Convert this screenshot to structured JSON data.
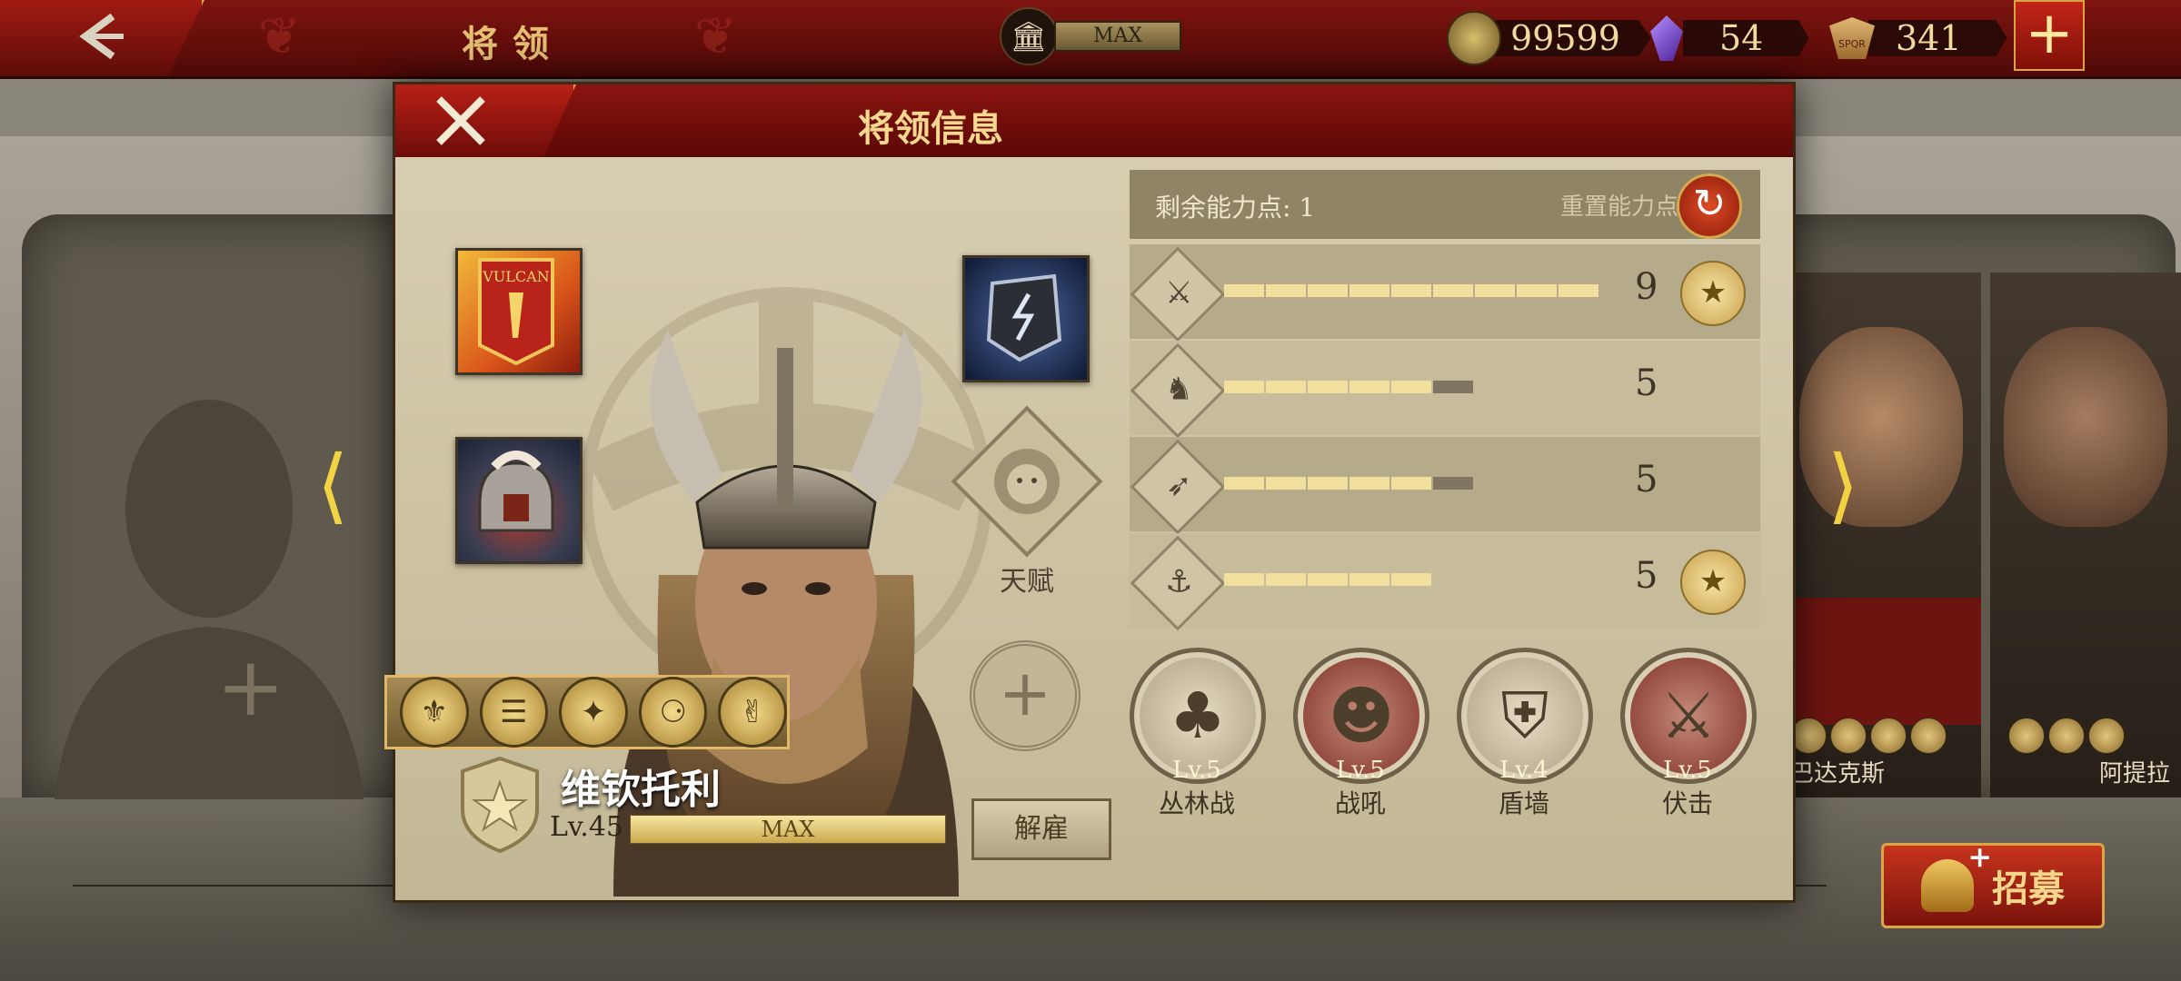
{
  "topbar": {
    "title": "将领",
    "building_max": "MAX",
    "gold": "99599",
    "gems": "54",
    "spqr": "341"
  },
  "dialog": {
    "title": "将领信息",
    "talent_label": "天赋",
    "general": {
      "name": "维钦托利",
      "level": "Lv.45",
      "exp_label": "MAX",
      "exp_fraction": 1.0
    },
    "dismiss_label": "解雇",
    "points": {
      "label": "剩余能力点: 1",
      "reset_label": "重置能力点"
    },
    "stats": [
      {
        "icon": "sword-icon",
        "value": "9",
        "filled": 9,
        "max": 9,
        "medal": true
      },
      {
        "icon": "horse-icon",
        "value": "5",
        "filled": 5,
        "max": 6,
        "medal": false
      },
      {
        "icon": "bow-icon",
        "value": "5",
        "filled": 5,
        "max": 6,
        "medal": false
      },
      {
        "icon": "anchor-icon",
        "value": "5",
        "filled": 5,
        "max": 5,
        "medal": true
      }
    ],
    "skills": [
      {
        "level": "Lv.5",
        "name": "丛林战",
        "icon": "forest-icon"
      },
      {
        "level": "Lv.5",
        "name": "战吼",
        "icon": "warcry-icon"
      },
      {
        "level": "Lv.4",
        "name": "盾墙",
        "icon": "shieldwall-icon"
      },
      {
        "level": "Lv.5",
        "name": "伏击",
        "icon": "ambush-icon"
      }
    ]
  },
  "side_cards": {
    "card1_name": "巴达克斯",
    "card2_name": "阿提拉"
  },
  "recruit_label": "招募",
  "colors": {
    "header_red": "#7f1410",
    "gold_text": "#f6d98e",
    "panel_bg": "#d9cfb4"
  }
}
